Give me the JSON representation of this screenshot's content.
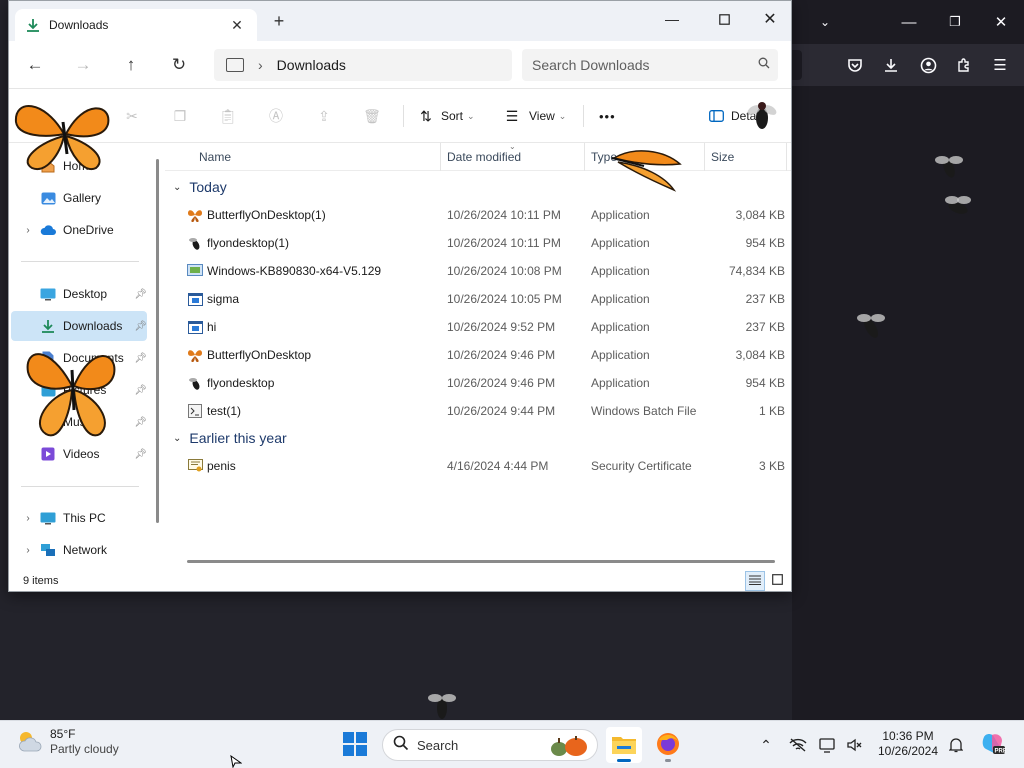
{
  "explorer": {
    "tab_title": "Downloads",
    "address": {
      "current": "Downloads"
    },
    "search": {
      "placeholder": "Search Downloads"
    },
    "commands": {
      "sort": "Sort",
      "view": "View",
      "more": "•••",
      "details": "Details"
    },
    "columns": {
      "name": "Name",
      "date": "Date modified",
      "type": "Type",
      "size": "Size"
    },
    "sidebar": {
      "home": "Home",
      "gallery": "Gallery",
      "onedrive": "OneDrive",
      "desktop": "Desktop",
      "downloads": "Downloads",
      "documents": "Documents",
      "pictures": "Pictures",
      "music": "Music",
      "videos": "Videos",
      "this_pc": "This PC",
      "network": "Network"
    },
    "groups": {
      "today": "Today",
      "earlier": "Earlier this year"
    },
    "files": [
      {
        "name": "ButterflyOnDesktop(1)",
        "date": "10/26/2024 10:11 PM",
        "type": "Application",
        "size": "3,084 KB",
        "icon": "butterfly-app-icon"
      },
      {
        "name": "flyondesktop(1)",
        "date": "10/26/2024 10:11 PM",
        "type": "Application",
        "size": "954 KB",
        "icon": "fly-app-icon"
      },
      {
        "name": "Windows-KB890830-x64-V5.129",
        "date": "10/26/2024 10:08 PM",
        "type": "Application",
        "size": "74,834 KB",
        "icon": "installer-app-icon"
      },
      {
        "name": "sigma",
        "date": "10/26/2024 10:05 PM",
        "type": "Application",
        "size": "237 KB",
        "icon": "generic-app-icon"
      },
      {
        "name": "hi",
        "date": "10/26/2024 9:52 PM",
        "type": "Application",
        "size": "237 KB",
        "icon": "generic-app-icon"
      },
      {
        "name": "ButterflyOnDesktop",
        "date": "10/26/2024 9:46 PM",
        "type": "Application",
        "size": "3,084 KB",
        "icon": "butterfly-app-icon"
      },
      {
        "name": "flyondesktop",
        "date": "10/26/2024 9:46 PM",
        "type": "Application",
        "size": "954 KB",
        "icon": "fly-app-icon"
      },
      {
        "name": "test(1)",
        "date": "10/26/2024 9:44 PM",
        "type": "Windows Batch File",
        "size": "1 KB",
        "icon": "batch-file-icon"
      }
    ],
    "earlier_files": [
      {
        "name": "penis",
        "date": "4/16/2024 4:44 PM",
        "type": "Security Certificate",
        "size": "3 KB",
        "icon": "certificate-icon"
      }
    ],
    "status": {
      "item_count": "9 items"
    }
  },
  "taskbar": {
    "weather": {
      "temp": "85°F",
      "condition": "Partly cloudy"
    },
    "search_label": "Search",
    "clock": {
      "time": "10:36 PM",
      "date": "10/26/2024"
    }
  },
  "colors": {
    "accent": "#0067c0",
    "selection": "#cce4f7",
    "desktop_bg": "#23232b",
    "firefox_toolbar": "#2b2a33"
  }
}
